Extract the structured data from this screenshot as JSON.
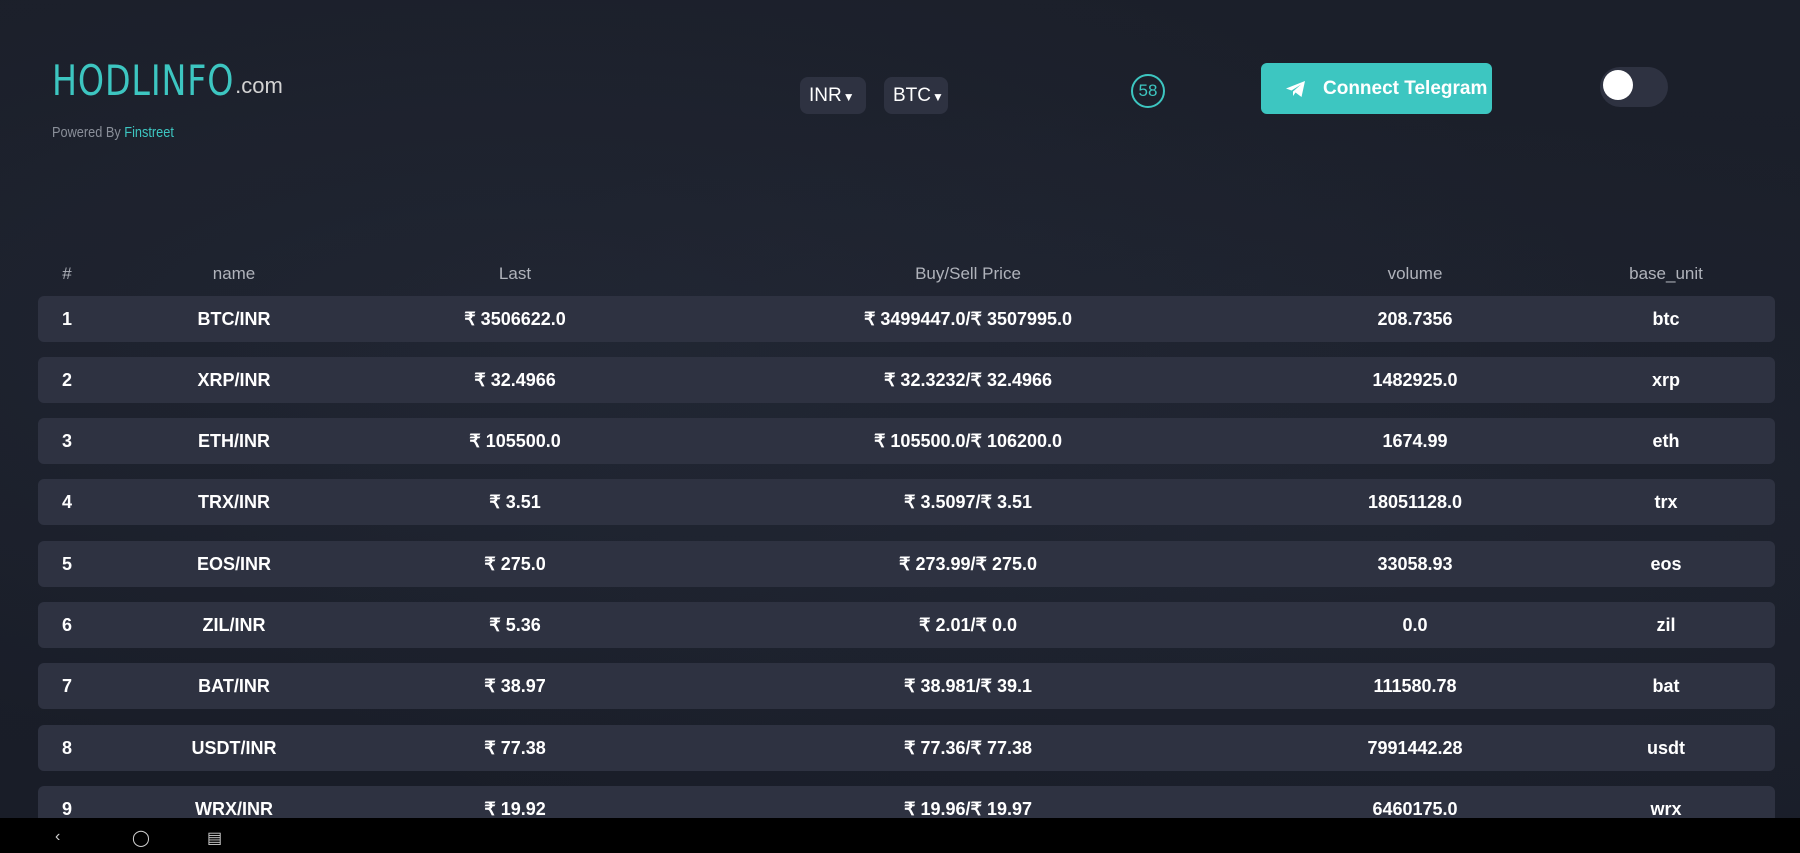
{
  "header": {
    "logo_main": "HODLINFO",
    "logo_suffix": ".com",
    "powered_by": "Powered By",
    "powered_brand": "Finstreet",
    "currency_label": "INR",
    "asset_label": "BTC",
    "timer_value": "58",
    "telegram_label": "Connect Telegram"
  },
  "table": {
    "columns": [
      "#",
      "name",
      "Last",
      "Buy/Sell Price",
      "volume",
      "base_unit"
    ],
    "rows": [
      {
        "num": "1",
        "name": "BTC/INR",
        "last": "₹ 3506622.0",
        "buy_sell": "₹ 3499447.0/₹ 3507995.0",
        "volume": "208.7356",
        "base": "btc"
      },
      {
        "num": "2",
        "name": "XRP/INR",
        "last": "₹ 32.4966",
        "buy_sell": "₹ 32.3232/₹ 32.4966",
        "volume": "1482925.0",
        "base": "xrp"
      },
      {
        "num": "3",
        "name": "ETH/INR",
        "last": "₹ 105500.0",
        "buy_sell": "₹ 105500.0/₹ 106200.0",
        "volume": "1674.99",
        "base": "eth"
      },
      {
        "num": "4",
        "name": "TRX/INR",
        "last": "₹ 3.51",
        "buy_sell": "₹ 3.5097/₹ 3.51",
        "volume": "18051128.0",
        "base": "trx"
      },
      {
        "num": "5",
        "name": "EOS/INR",
        "last": "₹ 275.0",
        "buy_sell": "₹ 273.99/₹ 275.0",
        "volume": "33058.93",
        "base": "eos"
      },
      {
        "num": "6",
        "name": "ZIL/INR",
        "last": "₹ 5.36",
        "buy_sell": "₹ 2.01/₹ 0.0",
        "volume": "0.0",
        "base": "zil"
      },
      {
        "num": "7",
        "name": "BAT/INR",
        "last": "₹ 38.97",
        "buy_sell": "₹ 38.981/₹ 39.1",
        "volume": "111580.78",
        "base": "bat"
      },
      {
        "num": "8",
        "name": "USDT/INR",
        "last": "₹ 77.38",
        "buy_sell": "₹ 77.36/₹ 77.38",
        "volume": "7991442.28",
        "base": "usdt"
      },
      {
        "num": "9",
        "name": "WRX/INR",
        "last": "₹ 19.92",
        "buy_sell": "₹ 19.96/₹ 19.97",
        "volume": "6460175.0",
        "base": "wrx"
      }
    ]
  },
  "colors": {
    "accent": "#3dc6c1",
    "background": "#191d28",
    "row_background": "#2e3241"
  },
  "icons": {
    "telegram": "paper-plane-icon",
    "theme_toggle": "toggle-switch"
  }
}
